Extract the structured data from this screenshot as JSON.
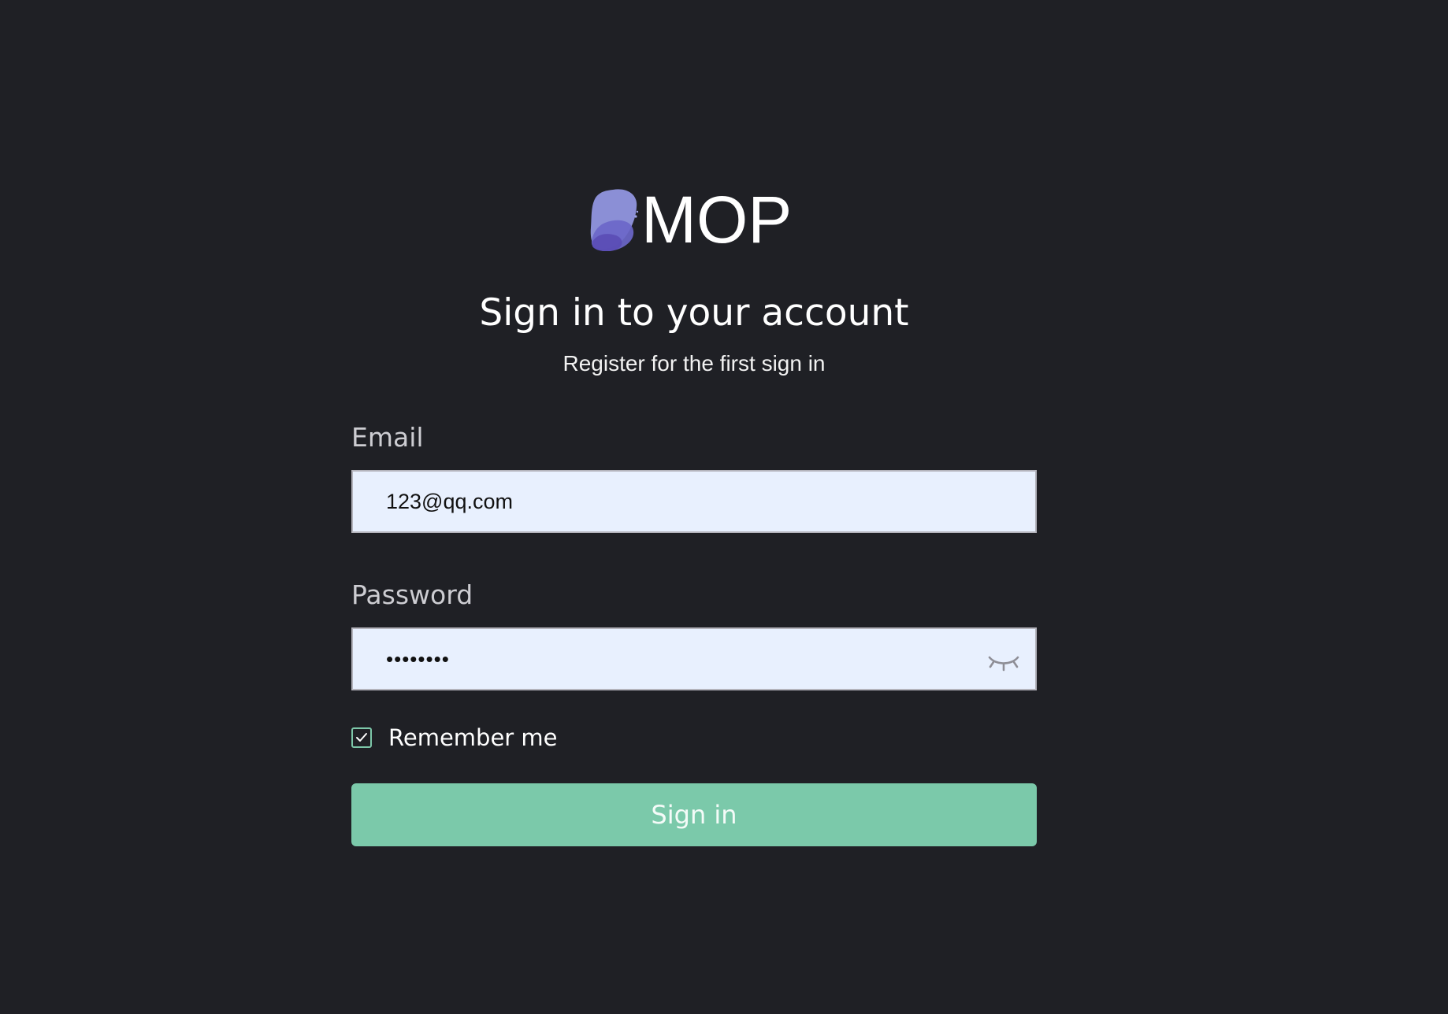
{
  "brand": {
    "name": "MOP",
    "logo_icon": "blob-logo-icon",
    "logo_colors": [
      "#8b8fd6",
      "#6c6ad0",
      "#5a4fb8"
    ]
  },
  "header": {
    "title": "Sign in to your account",
    "subtitle": "Register for the first sign in"
  },
  "form": {
    "email": {
      "label": "Email",
      "value": "123@qq.com"
    },
    "password": {
      "label": "Password",
      "value_masked": "••••••••",
      "toggle_icon": "eye-closed-icon"
    },
    "remember": {
      "label": "Remember me",
      "checked": true
    },
    "submit_label": "Sign in"
  },
  "colors": {
    "background": "#1f2025",
    "input_background": "#e8f0fe",
    "accent": "#7bc9aa"
  }
}
